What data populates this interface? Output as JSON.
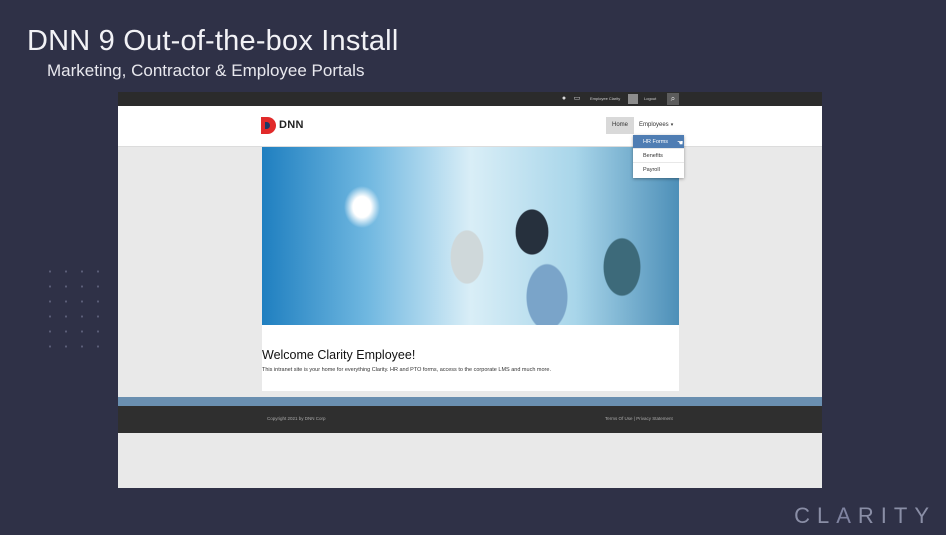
{
  "slide": {
    "title": "DNN 9 Out-of-the-box Install",
    "subtitle": "Marketing, Contractor & Employee Portals",
    "brand_left": "CL",
    "brand_accent": "A",
    "brand_right": "RITY"
  },
  "topbar": {
    "user_name": "Employee Clarity",
    "logout_label": "Logout",
    "notifications_icon": "chat-bubble-icon",
    "messages_icon": "messages-icon",
    "search_icon": "search-icon"
  },
  "header": {
    "logo_text": "DNN",
    "nav": {
      "home_label": "Home",
      "employees_label": "Employees",
      "employees_caret": "▾"
    },
    "dropdown": {
      "items": [
        {
          "label": "HR Forms",
          "active": true
        },
        {
          "label": "Benefits",
          "active": false
        },
        {
          "label": "Payroll",
          "active": false
        }
      ]
    }
  },
  "content": {
    "welcome_title": "Welcome Clarity Employee!",
    "intro_text": "This intranet site is your home for everything Clarity.  HR and PTO forms, access to the corporate LMS and much more."
  },
  "footer": {
    "copyright": "Copyright 2021 by DNN Corp",
    "terms_label": "Terms Of Use",
    "separator": "|",
    "privacy_label": "Privacy Statement"
  },
  "colors": {
    "slide_bg": "#2f3147",
    "topbar_bg": "#2b2b2b",
    "accent_blue": "#4f7db3",
    "stripe_blue": "#6a8fb0",
    "logo_red": "#e12a2a"
  }
}
